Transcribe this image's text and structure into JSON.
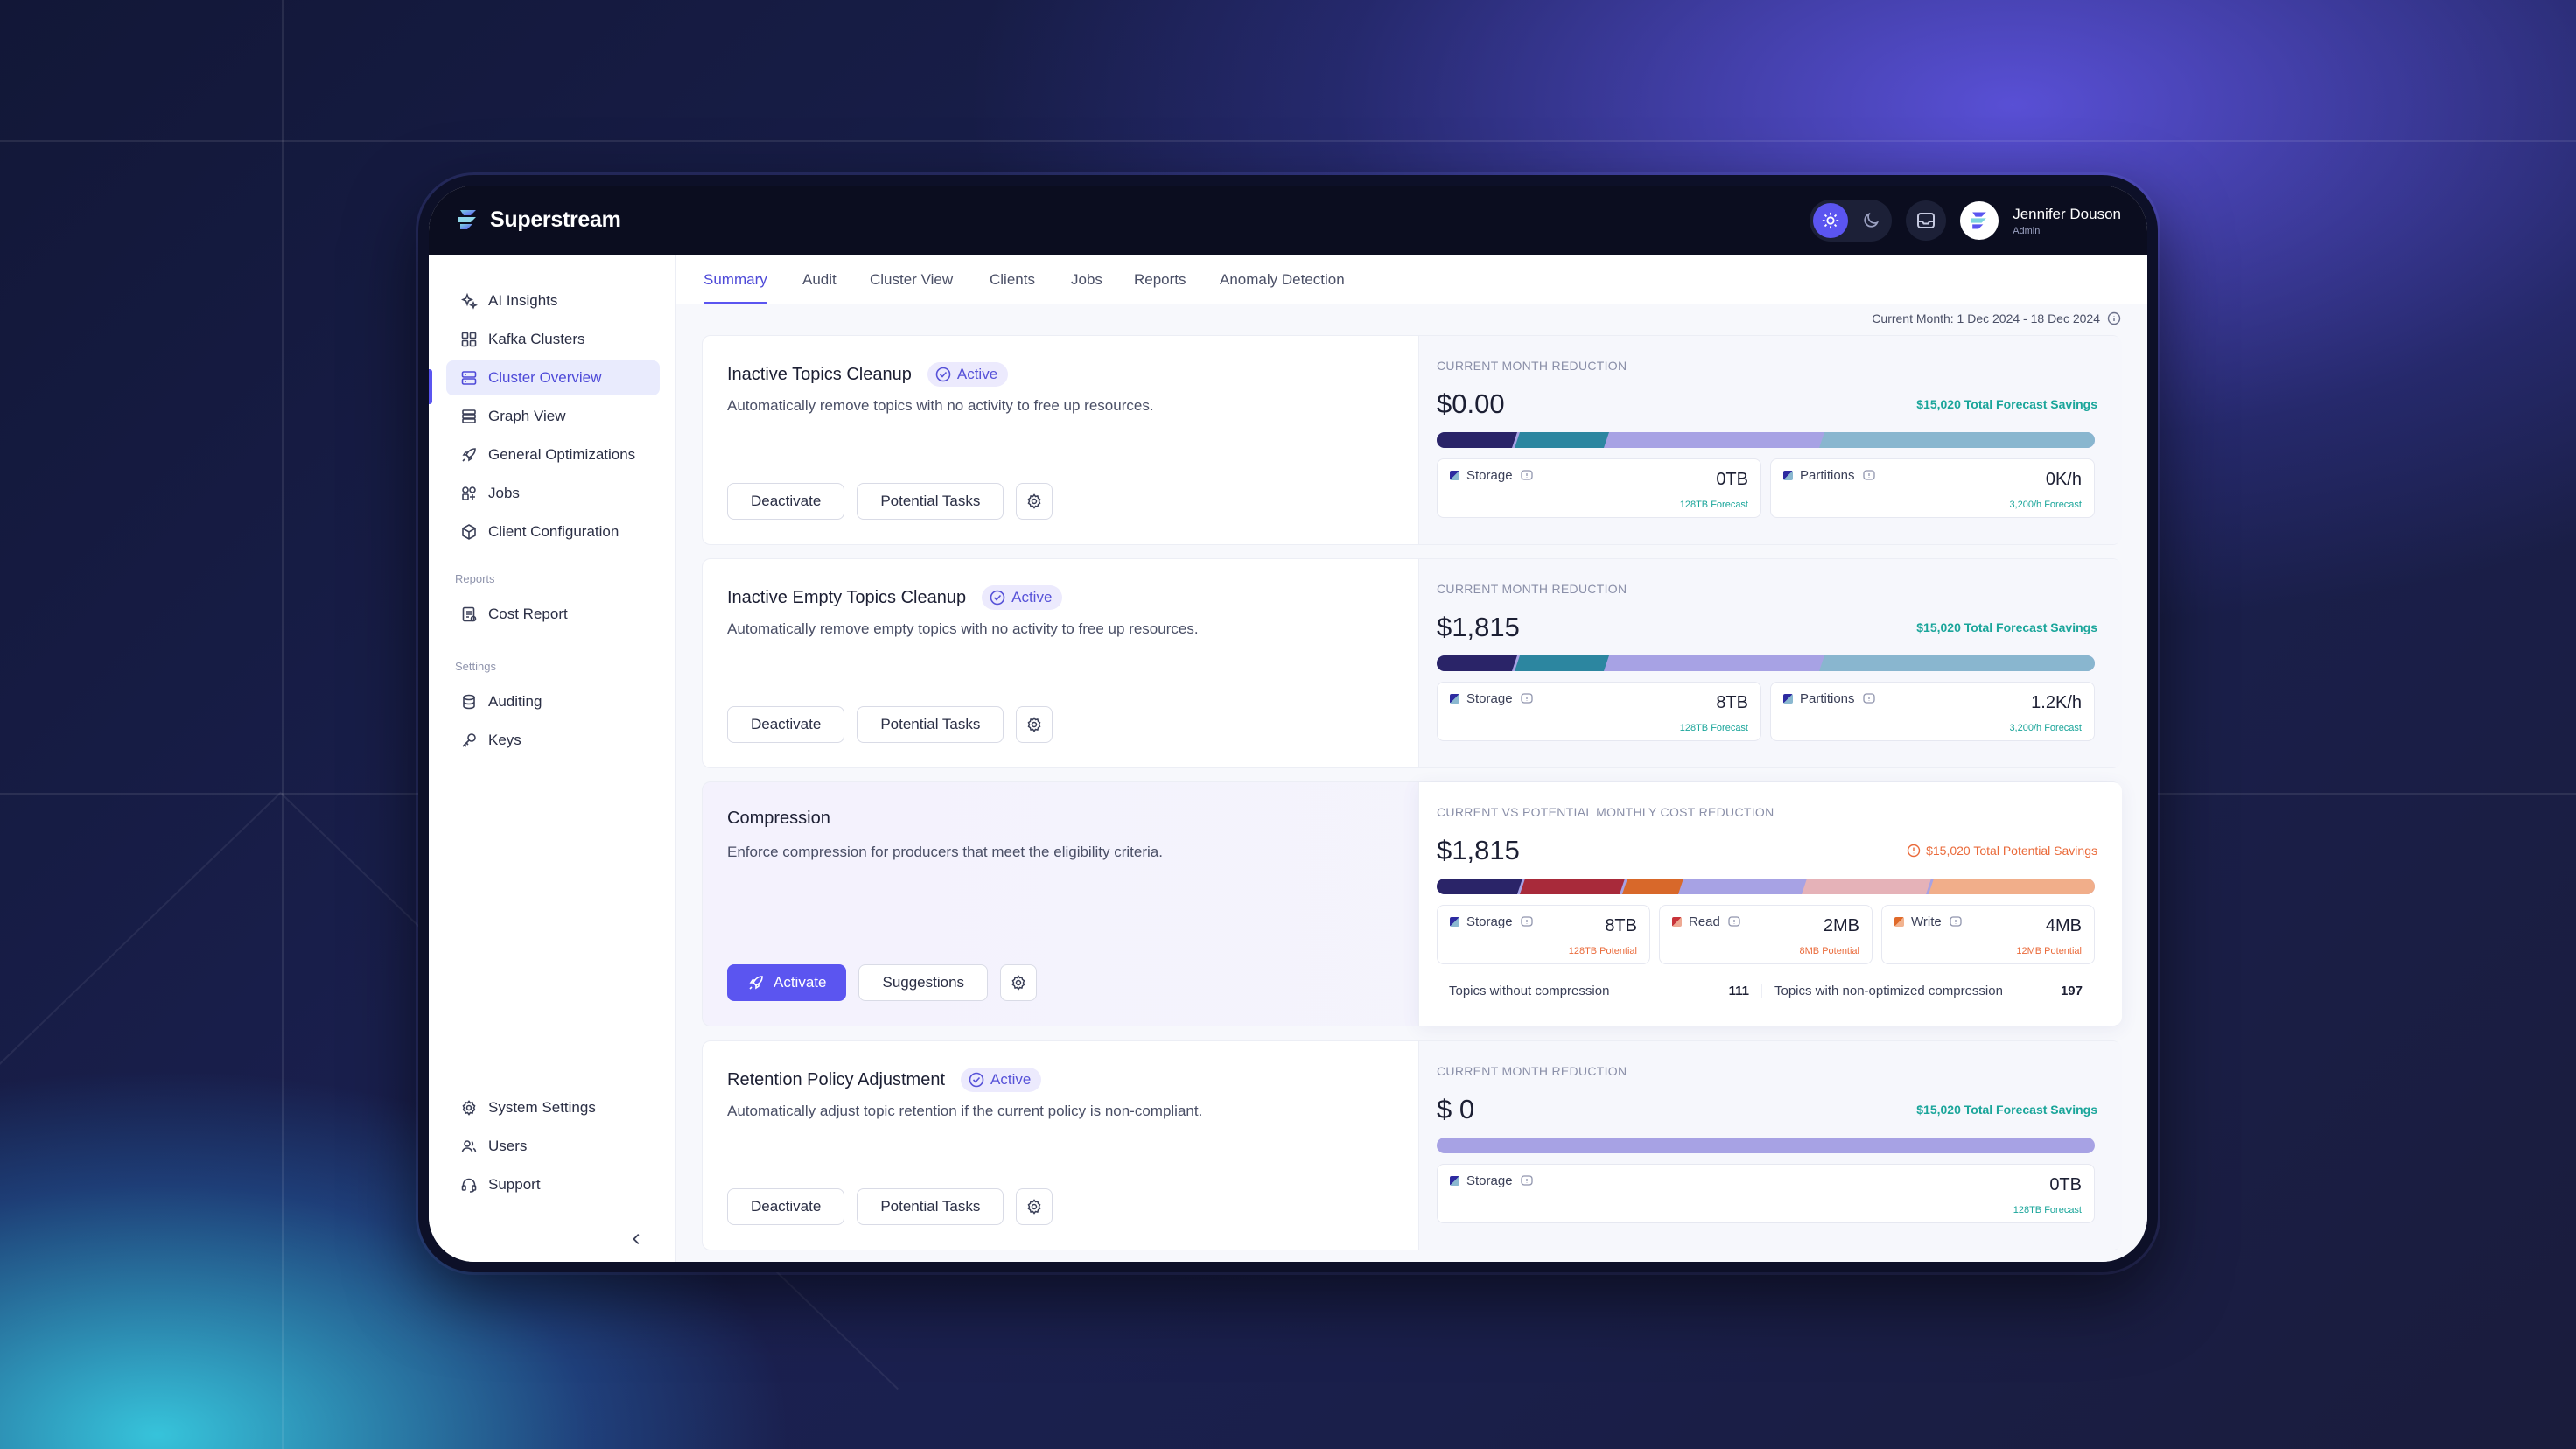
{
  "app": {
    "name": "Superstream"
  },
  "user": {
    "name": "Jennifer Douson",
    "role": "Admin"
  },
  "topbar": {
    "icons": [
      "sun-icon",
      "moon-icon",
      "inbox-icon"
    ]
  },
  "sidebar": {
    "items": [
      {
        "label": "AI Insights",
        "icon": "sparkle-icon"
      },
      {
        "label": "Kafka Clusters",
        "icon": "grid-icon"
      },
      {
        "label": "Cluster Overview",
        "icon": "server-icon",
        "active": true
      },
      {
        "label": "Graph View",
        "icon": "layers-icon"
      },
      {
        "label": "General Optimizations",
        "icon": "rocket-icon"
      },
      {
        "label": "Jobs",
        "icon": "jobs-icon"
      },
      {
        "label": "Client Configuration",
        "icon": "cube-icon"
      }
    ],
    "reports_heading": "Reports",
    "reports": [
      {
        "label": "Cost Report",
        "icon": "report-icon"
      }
    ],
    "settings_heading": "Settings",
    "settings": [
      {
        "label": "Auditing",
        "icon": "database-icon"
      },
      {
        "label": "Keys",
        "icon": "key-icon"
      }
    ],
    "bottom": [
      {
        "label": "System Settings",
        "icon": "gear-icon"
      },
      {
        "label": "Users",
        "icon": "users-icon"
      },
      {
        "label": "Support",
        "icon": "headset-icon"
      }
    ]
  },
  "tabs": [
    {
      "label": "Summary",
      "active": true
    },
    {
      "label": "Audit"
    },
    {
      "label": "Cluster View"
    },
    {
      "label": "Clients"
    },
    {
      "label": "Jobs"
    },
    {
      "label": "Reports"
    },
    {
      "label": "Anomaly Detection"
    }
  ],
  "period": "Current Month: 1 Dec 2024 - 18 Dec 2024",
  "colors": {
    "accent": "#5b55f0",
    "teal": "#1aa59a",
    "orange": "#ea6a3a"
  },
  "cards": [
    {
      "title": "Inactive Topics Cleanup",
      "status": "Active",
      "description": "Automatically remove topics with no activity to free up resources.",
      "buttons": [
        "Deactivate",
        "Potential Tasks"
      ],
      "right_label": "CURRENT MONTH REDUCTION",
      "value": "$0.00",
      "savings": "$15,020 Total Forecast Savings",
      "stats": [
        {
          "label": "Storage",
          "value": "0TB",
          "sub": "128TB Forecast"
        },
        {
          "label": "Partitions",
          "value": "0K/h",
          "sub": "3,200/h Forecast"
        }
      ]
    },
    {
      "title": "Inactive Empty Topics Cleanup",
      "status": "Active",
      "description": "Automatically remove empty topics with no activity to free up resources.",
      "buttons": [
        "Deactivate",
        "Potential Tasks"
      ],
      "right_label": "CURRENT MONTH REDUCTION",
      "value": "$1,815",
      "savings": "$15,020 Total Forecast Savings",
      "stats": [
        {
          "label": "Storage",
          "value": "8TB",
          "sub": "128TB Forecast"
        },
        {
          "label": "Partitions",
          "value": "1.2K/h",
          "sub": "3,200/h Forecast"
        }
      ]
    },
    {
      "title": "Compression",
      "description": "Enforce compression for producers that meet the eligibility criteria.",
      "buttons": [
        "Activate",
        "Suggestions"
      ],
      "right_label": "CURRENT VS POTENTIAL MONTHLY COST REDUCTION",
      "value": "$1,815",
      "savings": "$15,020 Total Potential Savings",
      "stats": [
        {
          "label": "Storage",
          "value": "8TB",
          "sub": "128TB Potential"
        },
        {
          "label": "Read",
          "value": "2MB",
          "sub": "8MB Potential"
        },
        {
          "label": "Write",
          "value": "4MB",
          "sub": "12MB Potential"
        }
      ],
      "meta": [
        {
          "label": "Topics without compression",
          "value": "111"
        },
        {
          "label": "Topics with non-optimized compression",
          "value": "197"
        }
      ]
    },
    {
      "title": "Retention Policy Adjustment",
      "status": "Active",
      "description": "Automatically adjust topic retention if the current policy is non-compliant.",
      "buttons": [
        "Deactivate",
        "Potential Tasks"
      ],
      "right_label": "CURRENT MONTH REDUCTION",
      "value": "$ 0",
      "savings": "$15,020 Total Forecast Savings",
      "stats": [
        {
          "label": "Storage",
          "value": "0TB",
          "sub": "128TB Forecast"
        }
      ]
    }
  ]
}
